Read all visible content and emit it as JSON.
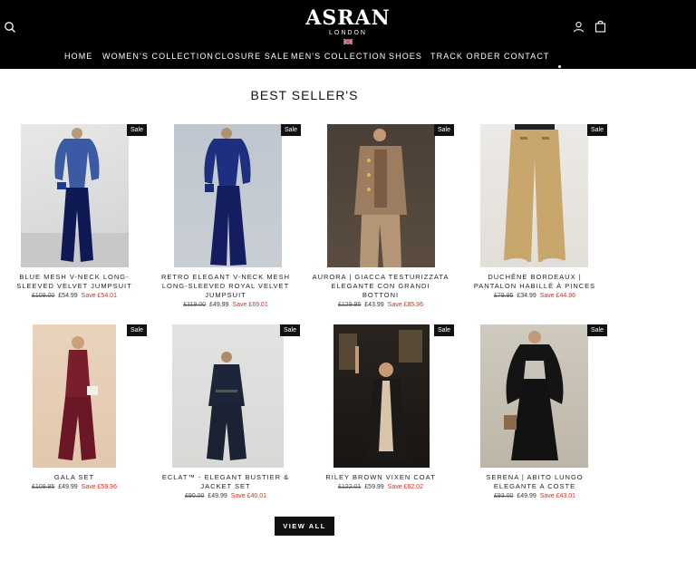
{
  "header": {
    "logo": "ASRAN",
    "logo_sub": "LONDON",
    "nav": [
      {
        "label": "HOME"
      },
      {
        "label": "WOMEN'S COLLECTION"
      },
      {
        "label": "CLOSURE SALE"
      },
      {
        "label": "MEN'S COLLECTION"
      },
      {
        "label": "SHOES"
      },
      {
        "label": "TRACK ORDER"
      },
      {
        "label": "CONTACT"
      }
    ],
    "icons": [
      "search-icon",
      "account-icon",
      "cart-icon"
    ]
  },
  "section_title": "BEST SELLER'S",
  "sale_badge": "Sale",
  "products": [
    {
      "title_lines": [
        "BLUE MESH V-NECK LONG-",
        "SLEEVED VELVET JUMPSUIT"
      ],
      "price_old": "£109.00",
      "price_new": "£54.99",
      "save": "Save £54.01",
      "image": "blue velvet jumpsuit"
    },
    {
      "title_lines": [
        "RETRO ELEGANT V-NECK MESH",
        "LONG-SLEEVED ROYAL VELVET",
        "JUMPSUIT"
      ],
      "price_old": "£119.00",
      "price_new": "£49.99",
      "save": "Save £69.01",
      "image": "royal velvet jumpsuit"
    },
    {
      "title_lines": [
        "AURORA | GIACCA TESTURIZZATA",
        "ELEGANTE CON GRANDI",
        "BOTTONI"
      ],
      "price_old": "£129.95",
      "price_new": "£43.99",
      "save": "Save £85.96",
      "image": "textured jacket"
    },
    {
      "title_lines": [
        "DUCHÊNE BORDEAUX |",
        "PANTALON HABILLÉ À PINCES"
      ],
      "price_old": "£79.95",
      "price_new": "£34.99",
      "save": "Save £44.96",
      "image": "pleated trousers"
    },
    {
      "title_lines": [
        "GALA SET"
      ],
      "price_old": "£109.95",
      "price_new": "£49.99",
      "save": "Save £59.96",
      "image": "gala set"
    },
    {
      "title_lines": [
        "ECLAT™ - ELEGANT BUSTIER &",
        "JACKET SET"
      ],
      "price_old": "£90.00",
      "price_new": "£49.99",
      "save": "Save £40.01",
      "image": "bustier jacket set"
    },
    {
      "title_lines": [
        "RILEY BROWN VIXEN COAT"
      ],
      "price_old": "£122.01",
      "price_new": "£59.99",
      "save": "Save £62.02",
      "image": "vixen coat"
    },
    {
      "title_lines": [
        "SERENA | ABITO LUNGO",
        "ELEGANTE A COSTE"
      ],
      "price_old": "£93.00",
      "price_new": "£49.99",
      "save": "Save £43.01",
      "image": "long ribbed dress"
    }
  ],
  "view_all": "VIEW ALL",
  "colors": {
    "header_bg": "#000000",
    "sale_text": "#c0392b",
    "badge_bg": "#111111"
  }
}
